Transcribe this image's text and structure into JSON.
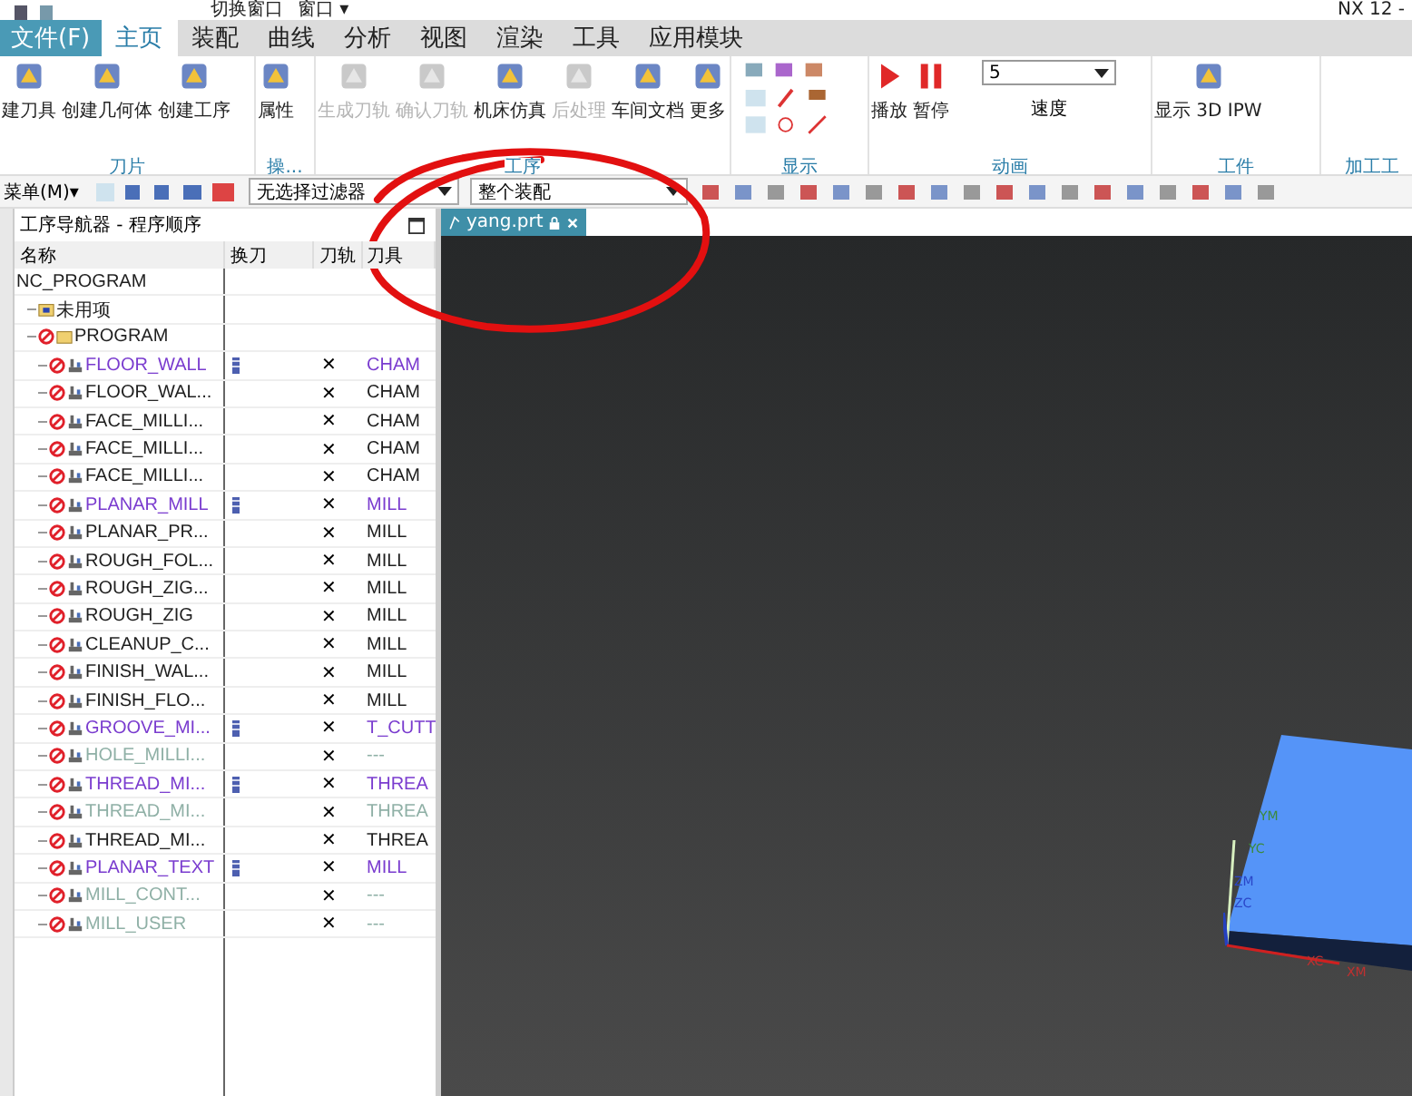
{
  "title_bar": {
    "items": [
      "切换窗口",
      "窗口 ▾"
    ],
    "app_title": "NX 12 -"
  },
  "file_menu": "文件(F)",
  "menu_tabs": [
    {
      "label": "主页",
      "selected": true
    },
    {
      "label": "装配",
      "selected": false
    },
    {
      "label": "曲线",
      "selected": false
    },
    {
      "label": "分析",
      "selected": false
    },
    {
      "label": "视图",
      "selected": false
    },
    {
      "label": "渲染",
      "selected": false
    },
    {
      "label": "工具",
      "selected": false
    },
    {
      "label": "应用模块",
      "selected": false
    }
  ],
  "ribbon": {
    "groups": [
      {
        "label": "刀片",
        "buttons": [
          {
            "label": "建刀具",
            "disabled": false
          },
          {
            "label": "创建几何体",
            "disabled": false
          },
          {
            "label": "创建工序",
            "disabled": false
          }
        ]
      },
      {
        "label": "操...",
        "buttons": [
          {
            "label": "属性",
            "disabled": false
          }
        ]
      },
      {
        "label": "工序",
        "buttons": [
          {
            "label": "生成刀轨",
            "disabled": true
          },
          {
            "label": "确认刀轨",
            "disabled": true
          },
          {
            "label": "机床仿真",
            "disabled": false
          },
          {
            "label": "后处理",
            "disabled": true
          },
          {
            "label": "车间文档",
            "disabled": false
          },
          {
            "label": "更多",
            "disabled": false
          }
        ]
      },
      {
        "label": "显示"
      },
      {
        "label": "动画",
        "buttons": [
          {
            "label": "播放",
            "disabled": false,
            "kind": "play"
          },
          {
            "label": "暂停",
            "disabled": false,
            "kind": "pause"
          }
        ],
        "speed": {
          "value": "5",
          "label": "速度"
        }
      },
      {
        "label": "工件",
        "buttons": [
          {
            "label": "显示 3D IPW",
            "disabled": false
          }
        ]
      },
      {
        "label": "加工工"
      }
    ]
  },
  "toolbar": {
    "menu": "菜单(M)▾",
    "filter": "无选择过滤器",
    "scope": "整个装配"
  },
  "navigator": {
    "title": "工序导航器 - 程序顺序",
    "columns": [
      "名称",
      "换刀",
      "刀轨",
      "刀具"
    ],
    "tree": [
      {
        "name": "NC_PROGRAM",
        "kind": "root",
        "children": [
          {
            "name": "未用项",
            "kind": "group"
          },
          {
            "name": "PROGRAM",
            "kind": "program",
            "children": [
              {
                "name": "FLOOR_WALL",
                "kind": "op",
                "color": "#7a3ccf",
                "tool_change": true,
                "path": "✕",
                "tool": "CHAM"
              },
              {
                "name": "FLOOR_WAL...",
                "kind": "op",
                "color": "#1e1e1e",
                "tool_change": false,
                "path": "✕",
                "tool": "CHAM"
              },
              {
                "name": "FACE_MILLI...",
                "kind": "op",
                "color": "#1e1e1e",
                "tool_change": false,
                "path": "✕",
                "tool": "CHAM"
              },
              {
                "name": "FACE_MILLI...",
                "kind": "op",
                "color": "#1e1e1e",
                "tool_change": false,
                "path": "✕",
                "tool": "CHAM"
              },
              {
                "name": "FACE_MILLI...",
                "kind": "op",
                "color": "#1e1e1e",
                "tool_change": false,
                "path": "✕",
                "tool": "CHAM"
              },
              {
                "name": "PLANAR_MILL",
                "kind": "op",
                "color": "#7a3ccf",
                "tool_change": true,
                "path": "✕",
                "tool": "MILL"
              },
              {
                "name": "PLANAR_PR...",
                "kind": "op",
                "color": "#1e1e1e",
                "tool_change": false,
                "path": "✕",
                "tool": "MILL"
              },
              {
                "name": "ROUGH_FOL...",
                "kind": "op",
                "color": "#1e1e1e",
                "tool_change": false,
                "path": "✕",
                "tool": "MILL"
              },
              {
                "name": "ROUGH_ZIG...",
                "kind": "op",
                "color": "#1e1e1e",
                "tool_change": false,
                "path": "✕",
                "tool": "MILL"
              },
              {
                "name": "ROUGH_ZIG",
                "kind": "op",
                "color": "#1e1e1e",
                "tool_change": false,
                "path": "✕",
                "tool": "MILL"
              },
              {
                "name": "CLEANUP_C...",
                "kind": "op",
                "color": "#1e1e1e",
                "tool_change": false,
                "path": "✕",
                "tool": "MILL"
              },
              {
                "name": "FINISH_WAL...",
                "kind": "op",
                "color": "#1e1e1e",
                "tool_change": false,
                "path": "✕",
                "tool": "MILL"
              },
              {
                "name": "FINISH_FLO...",
                "kind": "op",
                "color": "#1e1e1e",
                "tool_change": false,
                "path": "✕",
                "tool": "MILL"
              },
              {
                "name": "GROOVE_MI...",
                "kind": "op",
                "color": "#7a3ccf",
                "tool_change": true,
                "path": "✕",
                "tool": "T_CUTT"
              },
              {
                "name": "HOLE_MILLI...",
                "kind": "op",
                "color": "#8fb0a6",
                "tool_change": false,
                "path": "✕",
                "tool": "---"
              },
              {
                "name": "THREAD_MI...",
                "kind": "op",
                "color": "#7a3ccf",
                "tool_change": true,
                "path": "✕",
                "tool": "THREA"
              },
              {
                "name": "THREAD_MI...",
                "kind": "op",
                "color": "#8fb0a6",
                "tool_change": false,
                "path": "✕",
                "tool": "THREA"
              },
              {
                "name": "THREAD_MI...",
                "kind": "op",
                "color": "#1e1e1e",
                "tool_change": false,
                "path": "✕",
                "tool": "THREA"
              },
              {
                "name": "PLANAR_TEXT",
                "kind": "op",
                "color": "#7a3ccf",
                "tool_change": true,
                "path": "✕",
                "tool": "MILL"
              },
              {
                "name": "MILL_CONT...",
                "kind": "op",
                "color": "#8fb0a6",
                "tool_change": false,
                "path": "✕",
                "tool": "---"
              },
              {
                "name": "MILL_USER",
                "kind": "op",
                "color": "#8fb0a6",
                "tool_change": false,
                "path": "✕",
                "tool": "---"
              }
            ]
          }
        ]
      }
    ]
  },
  "viewport": {
    "tab": "yang.prt",
    "axis_labels": [
      "YM",
      "YC",
      "ZM",
      "ZC",
      "XC",
      "XM"
    ]
  }
}
